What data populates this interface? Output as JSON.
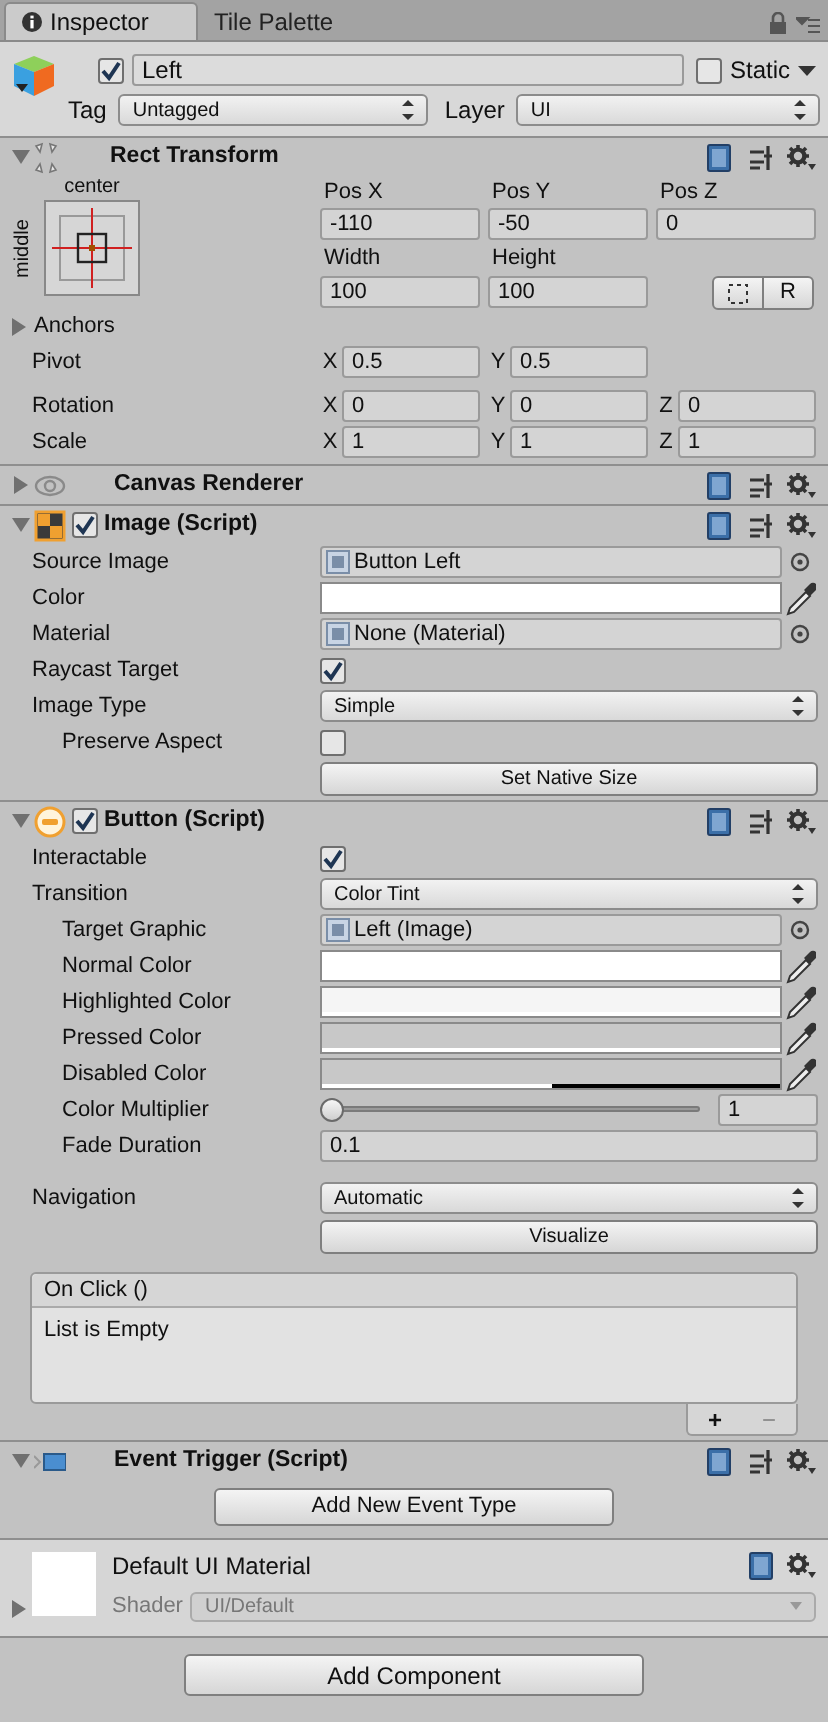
{
  "tabs": [
    {
      "label": "Inspector",
      "selected": true
    },
    {
      "label": "Tile Palette",
      "selected": false
    }
  ],
  "object": {
    "active": true,
    "name": "Left",
    "static": false,
    "static_label": "Static",
    "tag_label": "Tag",
    "tag": "Untagged",
    "layer_label": "Layer",
    "layer": "UI"
  },
  "rect_transform": {
    "title": "Rect Transform",
    "expanded": true,
    "anchor_h": "center",
    "anchor_v": "middle",
    "position": [
      {
        "label": "Pos X",
        "value": "-110"
      },
      {
        "label": "Pos Y",
        "value": "-50"
      },
      {
        "label": "Pos Z",
        "value": "0"
      }
    ],
    "size": [
      {
        "label": "Width",
        "value": "100"
      },
      {
        "label": "Height",
        "value": "100"
      }
    ],
    "raw_button": "R",
    "anchors": {
      "label": "Anchors",
      "expanded": false
    },
    "rows": [
      {
        "label": "Pivot",
        "axes": [
          {
            "axis": "X",
            "value": "0.5"
          },
          {
            "axis": "Y",
            "value": "0.5"
          }
        ]
      },
      {
        "label": "Rotation",
        "axes": [
          {
            "axis": "X",
            "value": "0"
          },
          {
            "axis": "Y",
            "value": "0"
          },
          {
            "axis": "Z",
            "value": "0"
          }
        ]
      },
      {
        "label": "Scale",
        "axes": [
          {
            "axis": "X",
            "value": "1"
          },
          {
            "axis": "Y",
            "value": "1"
          },
          {
            "axis": "Z",
            "value": "1"
          }
        ]
      }
    ]
  },
  "components": [
    {
      "kind": "eye",
      "title": "Canvas Renderer",
      "expanded": false
    },
    {
      "kind": "image",
      "title": "Image (Script)",
      "expanded": true,
      "enabled": true,
      "rows": [
        {
          "kind": "object",
          "label": "Source Image",
          "value": "Button Left",
          "indented": false
        },
        {
          "kind": "color",
          "label": "Color",
          "color": "#ffffff",
          "level": 1,
          "indented": false
        },
        {
          "kind": "object",
          "label": "Material",
          "value": "None (Material)",
          "indented": false
        },
        {
          "kind": "checkbox",
          "label": "Raycast Target",
          "checked": true,
          "indented": false
        },
        {
          "kind": "dropdown",
          "label": "Image Type",
          "value": "Simple",
          "indented": false
        },
        {
          "kind": "checkbox",
          "label": "Preserve Aspect",
          "checked": false,
          "indented": true
        },
        {
          "kind": "button",
          "text": "Set Native Size"
        }
      ]
    },
    {
      "kind": "button",
      "title": "Button (Script)",
      "expanded": true,
      "enabled": true,
      "rows": [
        {
          "kind": "checkbox",
          "label": "Interactable",
          "checked": true,
          "indented": false
        },
        {
          "kind": "dropdown",
          "label": "Transition",
          "value": "Color Tint",
          "indented": false
        },
        {
          "kind": "object",
          "label": "Target Graphic",
          "value": "Left (Image)",
          "indented": true
        },
        {
          "kind": "color",
          "label": "Normal Color",
          "color": "#ffffff",
          "level": 1,
          "indented": true
        },
        {
          "kind": "color",
          "label": "Highlighted Color",
          "color": "#f5f5f5",
          "level": 1,
          "indented": true
        },
        {
          "kind": "color",
          "label": "Pressed Color",
          "color": "#c8c8c8",
          "level": 1,
          "indented": true
        },
        {
          "kind": "color",
          "label": "Disabled Color",
          "color": "#c8c8c8",
          "level": 0.5,
          "indented": true
        },
        {
          "kind": "slider",
          "label": "Color Multiplier",
          "level": 0,
          "value": "1",
          "indented": true
        },
        {
          "kind": "text",
          "label": "Fade Duration",
          "value": "0.1",
          "indented": true
        }
      ],
      "navigation": {
        "label": "Navigation",
        "value": "Automatic",
        "button": "Visualize"
      },
      "event": {
        "title": "On Click ()",
        "empty_text": "List is Empty",
        "add": "+",
        "remove": "−"
      }
    },
    {
      "kind": "event",
      "title": "Event Trigger (Script)",
      "expanded": true,
      "add_button": "Add New Event Type"
    }
  ],
  "material": {
    "name": "Default UI Material",
    "shader_label": "Shader",
    "shader": "UI/Default"
  },
  "add_component": "Add Component"
}
